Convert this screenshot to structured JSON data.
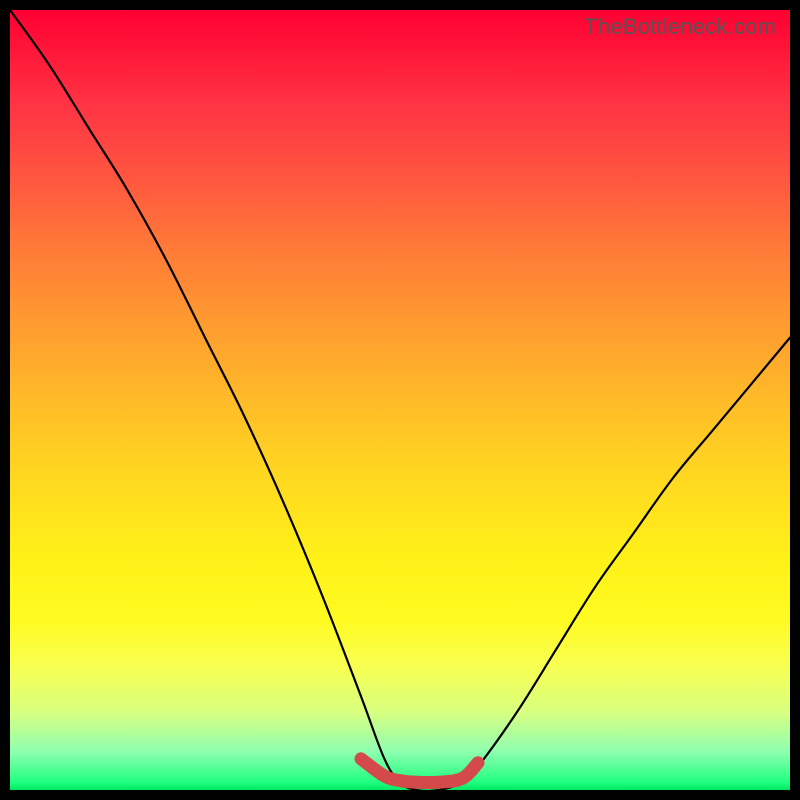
{
  "watermark": "TheBottleneck.com",
  "chart_data": {
    "type": "line",
    "title": "",
    "xlabel": "",
    "ylabel": "",
    "xlim": [
      0,
      100
    ],
    "ylim": [
      0,
      100
    ],
    "grid": false,
    "background_gradient": {
      "top": "#ff0033",
      "upper_mid": "#ff9a30",
      "mid": "#ffd820",
      "lower_mid": "#f8ff50",
      "bottom": "#00e860"
    },
    "series": [
      {
        "name": "bottleneck-curve",
        "color": "#000000",
        "width": 2,
        "x": [
          0,
          5,
          10,
          15,
          20,
          25,
          30,
          35,
          40,
          45,
          48,
          50,
          52,
          55,
          58,
          60,
          65,
          70,
          75,
          80,
          85,
          90,
          95,
          100
        ],
        "y": [
          100,
          93,
          85,
          77,
          68,
          58,
          48,
          37,
          25,
          12,
          4,
          1,
          0,
          0,
          1,
          3,
          10,
          18,
          26,
          33,
          40,
          46,
          52,
          58
        ]
      },
      {
        "name": "optimal-zone-highlight",
        "color": "#d44a4a",
        "width": 10,
        "x": [
          45,
          48,
          50,
          52,
          55,
          58,
          60
        ],
        "y": [
          4,
          1.8,
          1.2,
          1.0,
          1.0,
          1.5,
          3.5
        ]
      }
    ]
  }
}
